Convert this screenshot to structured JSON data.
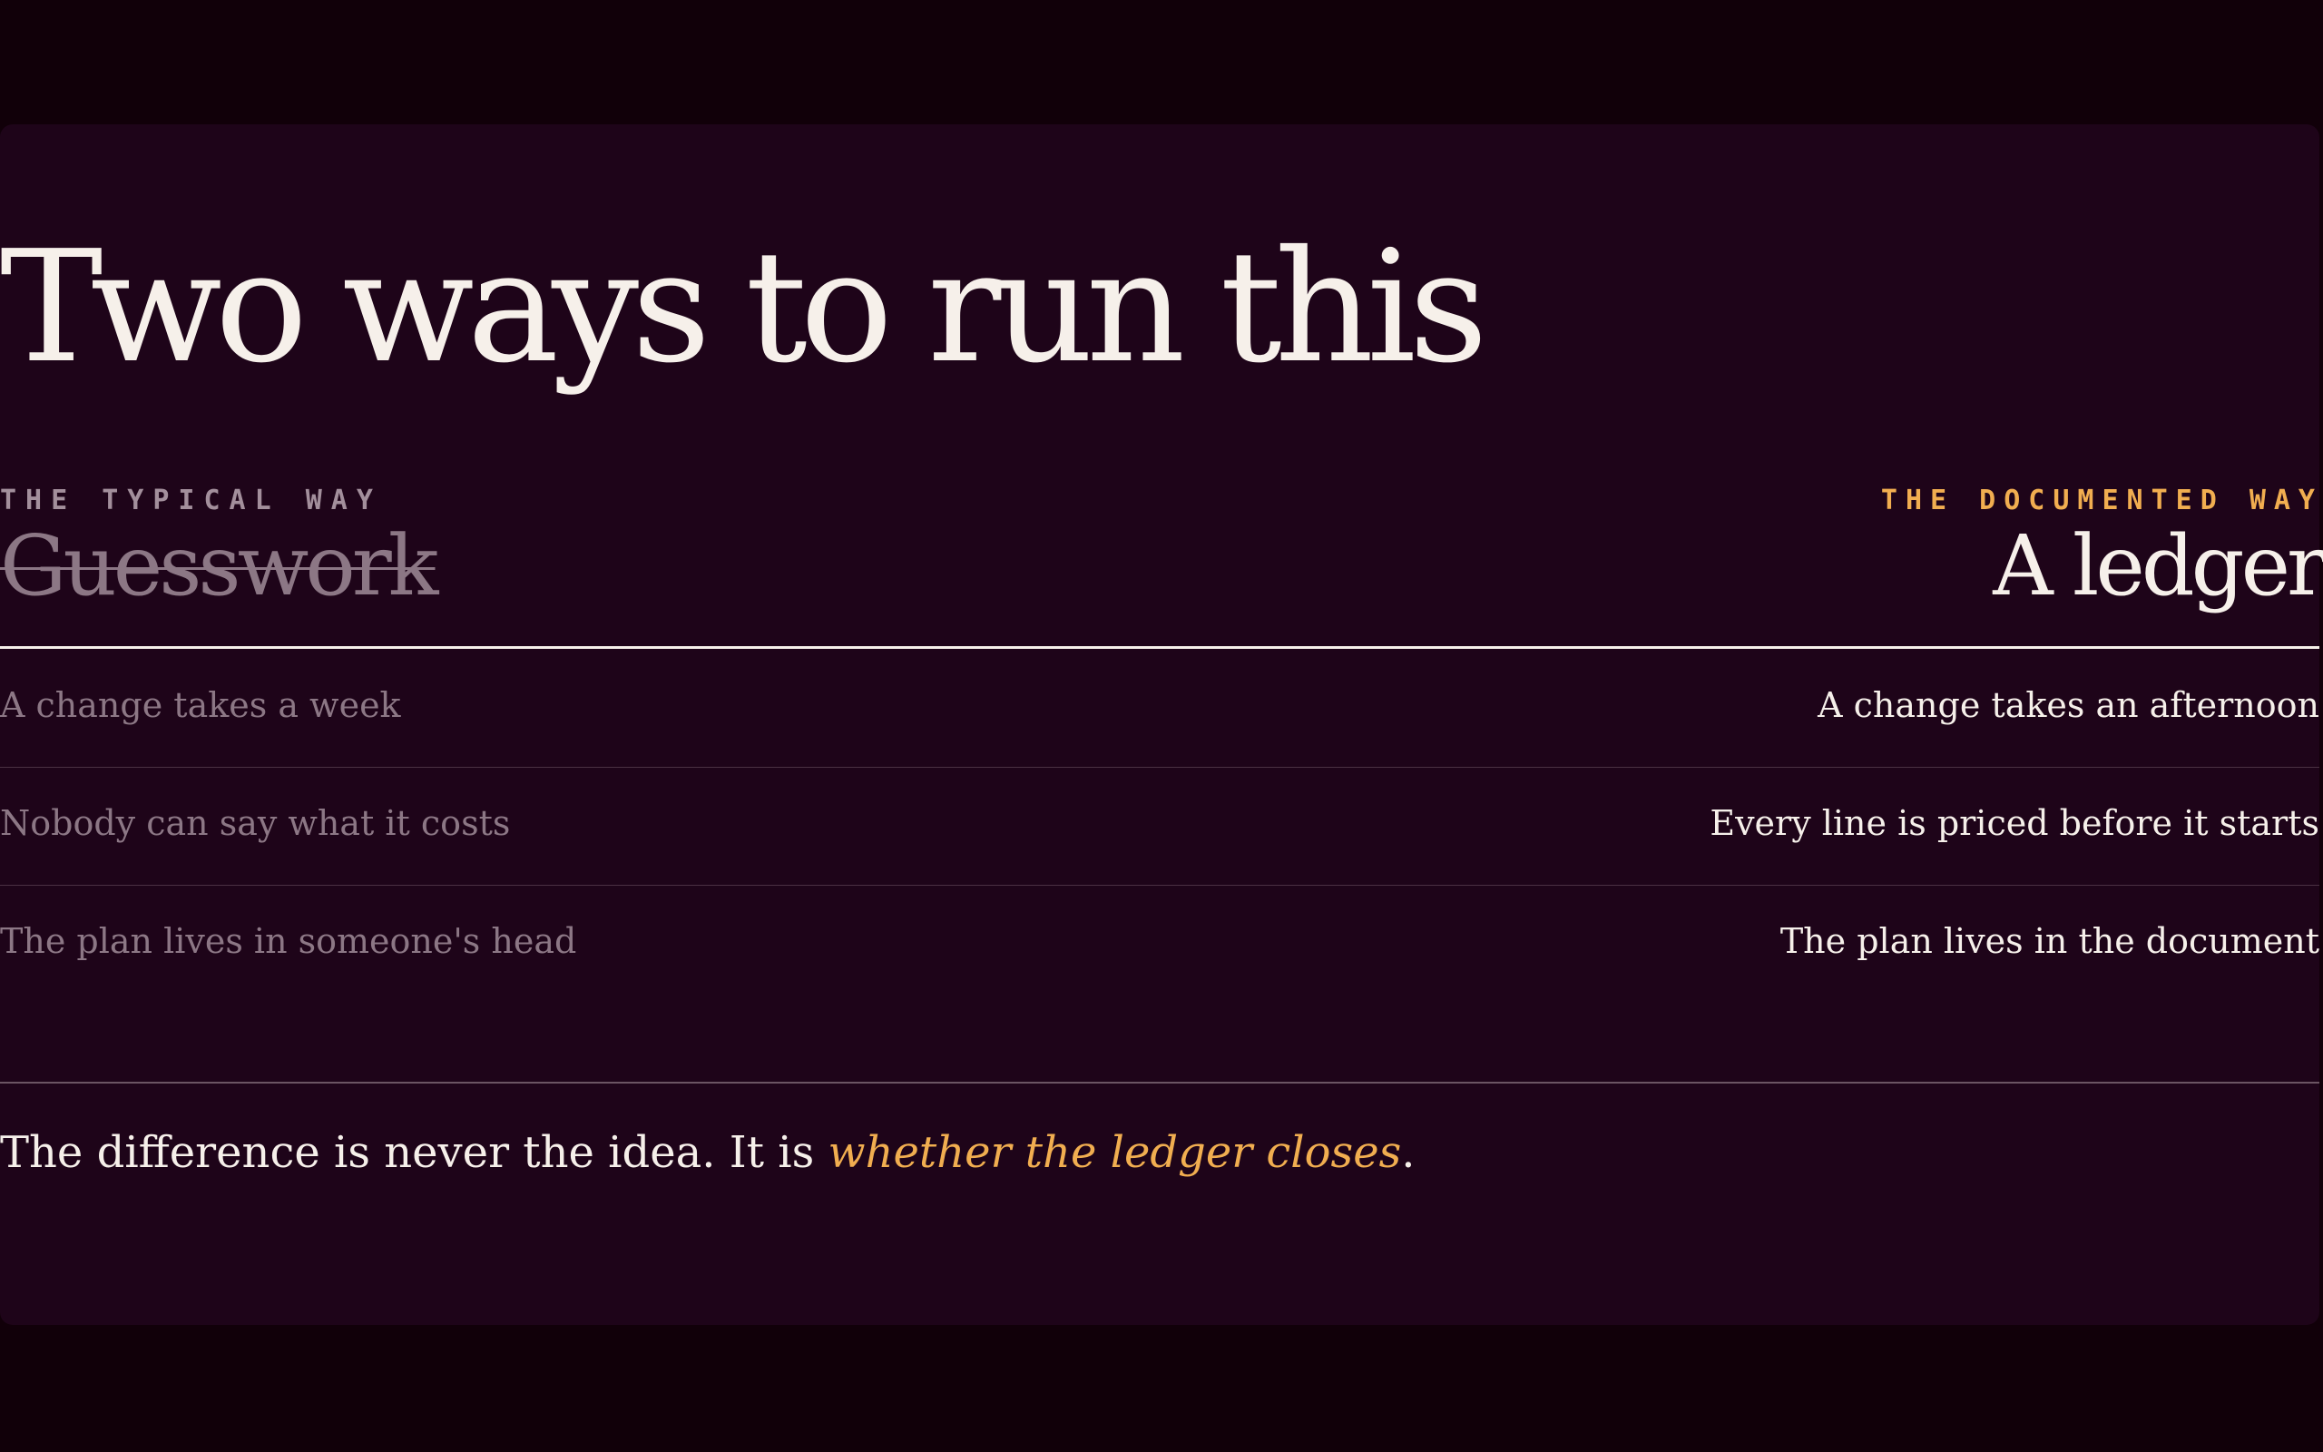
{
  "heading": "Two ways to run this",
  "typical": {
    "eyebrow": "THE TYPICAL WAY",
    "title": "Guesswork"
  },
  "documented": {
    "eyebrow": "THE DOCUMENTED WAY",
    "title": "A ledger"
  },
  "rows": [
    {
      "typical": "A change takes a week",
      "documented": "A change takes an afternoon"
    },
    {
      "typical": "Nobody can say what it costs",
      "documented": "Every line is priced before it starts"
    },
    {
      "typical": "The plan lives in someone's head",
      "documented": "The plan lives in the document"
    }
  ],
  "footer": {
    "lead": "The difference is never the idea. It is ",
    "emphasis": "whether the ledger closes",
    "end": "."
  },
  "colors": {
    "background": "#110009",
    "card": "#1e0419",
    "text": "#f6f0ea",
    "muted": "#8c7785",
    "accent": "#f1ae50"
  }
}
